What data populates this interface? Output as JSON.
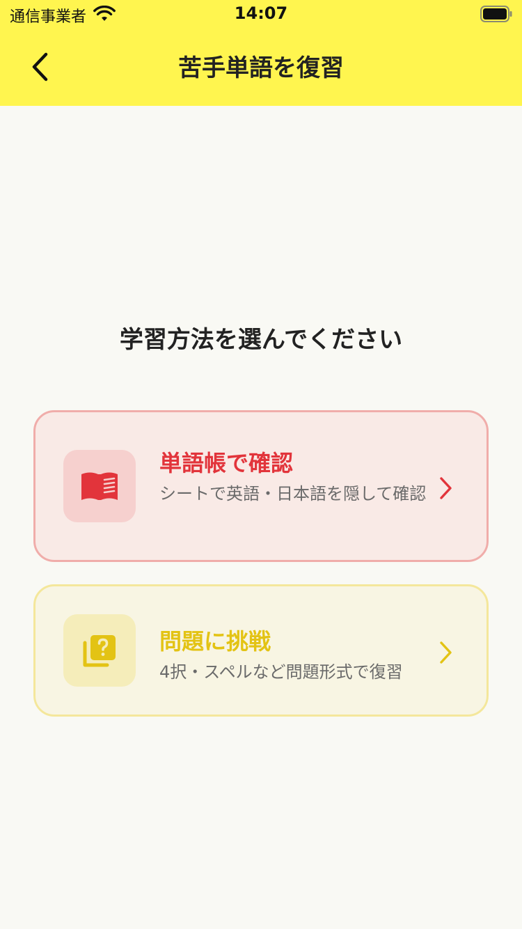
{
  "status_bar": {
    "carrier": "通信事業者",
    "time": "14:07",
    "wifi_icon": "wifi-icon",
    "battery_icon": "battery-icon"
  },
  "nav": {
    "back_icon": "chevron-left-icon",
    "title": "苦手単語を復習"
  },
  "prompt": "学習方法を選んでください",
  "options": [
    {
      "title": "単語帳で確認",
      "description": "シートで英語・日本語を隠して確認",
      "icon": "book-open-icon",
      "accent": "#E2343B"
    },
    {
      "title": "問題に挑戦",
      "description": "4択・スペルなど問題形式で復習",
      "icon": "quiz-cards-icon",
      "accent": "#E3C314"
    }
  ],
  "colors": {
    "header_bg": "#FFF54F",
    "page_bg": "#F9F9F4"
  }
}
